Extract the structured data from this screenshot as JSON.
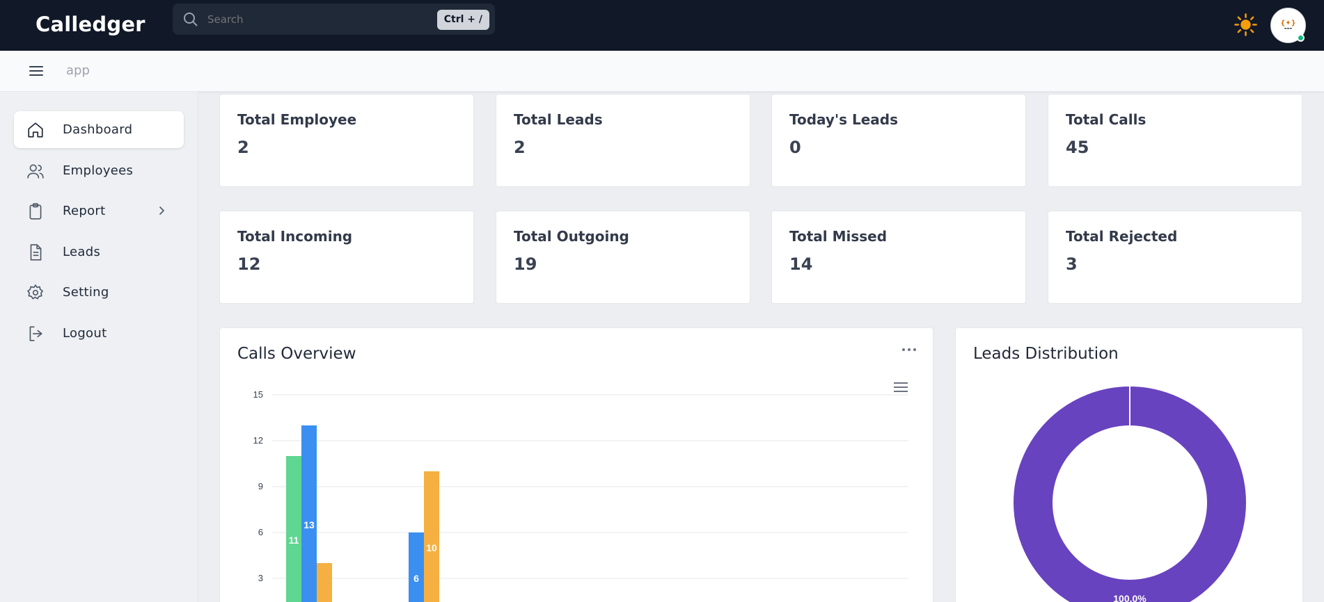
{
  "app": {
    "brand": "Calledger"
  },
  "search": {
    "placeholder": "Search",
    "shortcut": "Ctrl + /"
  },
  "breadcrumb": {
    "current": "app"
  },
  "sidebar": {
    "items": [
      {
        "label": "Dashboard",
        "icon": "home-icon",
        "active": true
      },
      {
        "label": "Employees",
        "icon": "users-icon",
        "active": false
      },
      {
        "label": "Report",
        "icon": "clipboard-icon",
        "active": false,
        "has_submenu": true
      },
      {
        "label": "Leads",
        "icon": "document-icon",
        "active": false
      },
      {
        "label": "Setting",
        "icon": "gear-icon",
        "active": false
      },
      {
        "label": "Logout",
        "icon": "logout-icon",
        "active": false
      }
    ]
  },
  "stats": [
    {
      "title": "Total Employee",
      "value": "2"
    },
    {
      "title": "Total Leads",
      "value": "2"
    },
    {
      "title": "Today's Leads",
      "value": "0"
    },
    {
      "title": "Total Calls",
      "value": "45"
    },
    {
      "title": "Total Incoming",
      "value": "12"
    },
    {
      "title": "Total Outgoing",
      "value": "19"
    },
    {
      "title": "Total Missed",
      "value": "14"
    },
    {
      "title": "Total Rejected",
      "value": "3"
    }
  ],
  "calls_overview": {
    "title": "Calls Overview"
  },
  "leads_distribution": {
    "title": "Leads Distribution"
  },
  "chart_data": [
    {
      "type": "bar",
      "title": "Calls Overview",
      "y_ticks": [
        "15",
        "12",
        "9",
        "6",
        "3"
      ],
      "ylim": [
        0,
        15
      ],
      "grid": true,
      "groups": [
        {
          "values": [
            11,
            13,
            4
          ],
          "labels": [
            "11",
            "13",
            ""
          ]
        },
        {
          "values": [
            0,
            6,
            10
          ],
          "labels": [
            "",
            "6",
            "10"
          ]
        }
      ],
      "series_colors": [
        "#5fd691",
        "#3b8ff0",
        "#f5b041"
      ]
    },
    {
      "type": "pie",
      "title": "Leads Distribution",
      "slices": [
        {
          "value": 100.0,
          "label": "100.0%",
          "color": "#6843bf"
        }
      ]
    }
  ],
  "colors": {
    "topbar": "#111827",
    "accent_purple": "#6843bf",
    "online": "#10b981"
  }
}
